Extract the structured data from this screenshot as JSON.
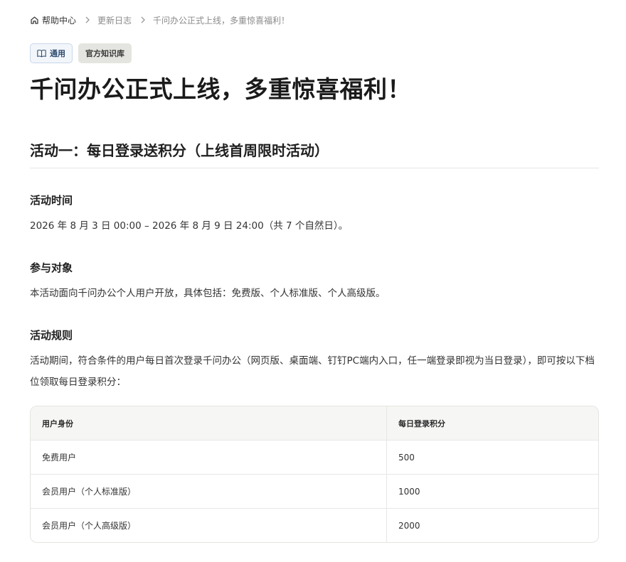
{
  "breadcrumb": {
    "home": "帮助中心",
    "items": [
      "更新日志",
      "千问办公正式上线，多重惊喜福利！"
    ]
  },
  "tags": {
    "general": "通用",
    "knowledge_base": "官方知识库"
  },
  "title": "千问办公正式上线，多重惊喜福利！",
  "section": {
    "heading": "活动一：每日登录送积分（上线首周限时活动）",
    "time_heading": "活动时间",
    "time_text": "2026 年 8 月 3 日 00:00 – 2026 年 8 月 9 日 24:00（共 7 个自然日）。",
    "audience_heading": "参与对象",
    "audience_text": "本活动面向千问办公个人用户开放，具体包括：免费版、个人标准版、个人高级版。",
    "rules_heading": "活动规则",
    "rules_text": "活动期间，符合条件的用户每日首次登录千问办公（网页版、桌面端、钉钉PC端内入口，任一端登录即视为当日登录），即可按以下档位领取每日登录积分："
  },
  "table": {
    "headers": [
      "用户身份",
      "每日登录积分"
    ],
    "rows": [
      [
        "免费用户",
        "500"
      ],
      [
        "会员用户（个人标准版）",
        "1000"
      ],
      [
        "会员用户（个人高级版）",
        "2000"
      ]
    ]
  },
  "colors": {
    "tag_general_bg": "#f2f6fb",
    "tag_general_border": "#c8d7ea",
    "tag_kb_bg": "#e4e4e0",
    "table_header_bg": "#f6f7f4"
  }
}
